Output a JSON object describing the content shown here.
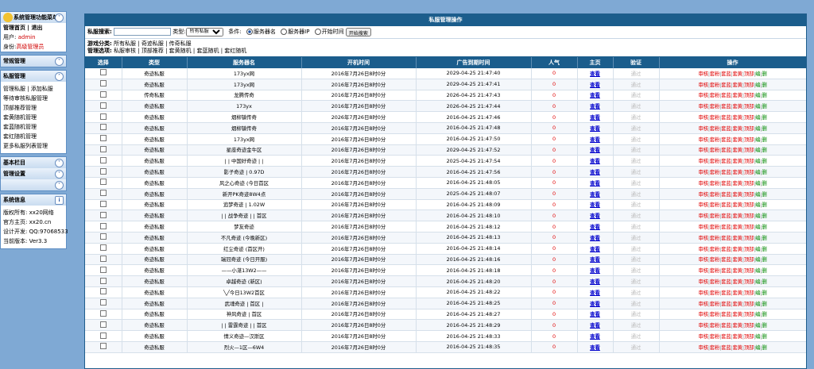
{
  "sidebar": {
    "title": "系统管理功能菜单",
    "home_label": "管理首页",
    "logout_label": "退出",
    "user_label": "用户:",
    "user_value": "admin",
    "role_label": "身份:",
    "role_value": "高级管理员",
    "sections": [
      {
        "label": "常规管理"
      },
      {
        "label": "私服管理",
        "items": [
          "管理私服 | 添加私服",
          "等待审核私服管理",
          "顶部推荐管理",
          "套黄随机管理",
          "套蓝随机管理",
          "套红随机管理",
          "更多私服列表管理"
        ]
      },
      {
        "label": "基本栏目"
      },
      {
        "label": "管理设置"
      }
    ],
    "sysinfo": {
      "title": "系统信息",
      "lines": [
        "版权所有: xx20网络",
        "官方主页: xx20.cn",
        "设计开发: QQ:97068533",
        "当前版本: Ver3.3"
      ]
    }
  },
  "main": {
    "title": "私服管理操作",
    "search": {
      "label": "私服搜索:",
      "input_value": "",
      "type_label": "类型:",
      "type_selected": "所有私服",
      "condition_label": "条件:",
      "options": [
        "服务器名",
        "服务器IP",
        "开始时间"
      ],
      "selected_option": 0,
      "button_label": "开始搜索"
    },
    "filters": {
      "cat_label": "游戏分类:",
      "cat_items": "所有私服 | 奇迹私服 | 传奇私服",
      "mgr_label": "管理选项:",
      "mgr_items": "私服审核 | 顶部推荐 | 套黄随机 | 套蓝随机 | 套红随机"
    },
    "columns": [
      "选择",
      "类型",
      "服务器名",
      "开机时间",
      "广告到期时间",
      "人气",
      "主页",
      "验证",
      "操作"
    ],
    "row_constants": {
      "popularity": "0",
      "homepage": "查看",
      "verify": "通过",
      "ops": [
        "审核",
        "套粉",
        "套蓝",
        "套黄",
        "顶部",
        "编",
        "删"
      ]
    },
    "rows": [
      {
        "type": "奇迹私服",
        "name": "173yx网",
        "start": "2016年7月26日8时0分",
        "expire": "2029-04-25 21:47:40"
      },
      {
        "type": "奇迹私服",
        "name": "173yx网",
        "start": "2016年7月26日8时0分",
        "expire": "2029-04-25 21:47:41"
      },
      {
        "type": "传奇私服",
        "name": "龙腾传奇",
        "start": "2016年7月26日8时0分",
        "expire": "2026-04-25 21:47:43"
      },
      {
        "type": "奇迹私服",
        "name": "173yx",
        "start": "2016年7月26日8时0分",
        "expire": "2026-04-25 21:47:44"
      },
      {
        "type": "奇迹私服",
        "name": "烟柳镇传奇",
        "start": "2026年7月26日8时0分",
        "expire": "2016-04-25 21:47:46"
      },
      {
        "type": "奇迹私服",
        "name": "烟柳镇传奇",
        "start": "2016年7月26日8时0分",
        "expire": "2016-04-25 21:47:48"
      },
      {
        "type": "奇迹私服",
        "name": "173yx网",
        "start": "2016年7月26日8时0分",
        "expire": "2016-04-25 21:47:50"
      },
      {
        "type": "奇迹私服",
        "name": "星座奇迹金牛区",
        "start": "2016年7月26日8时0分",
        "expire": "2029-04-25 21:47:52"
      },
      {
        "type": "奇迹私服",
        "name": "| | 中国好奇迹 | |",
        "start": "2016年7月26日8时0分",
        "expire": "2025-04-25 21:47:54"
      },
      {
        "type": "奇迹私服",
        "name": "影子奇迹 | 0.97D",
        "start": "2016年7月26日8时0分",
        "expire": "2016-04-25 21:47:56"
      },
      {
        "type": "奇迹私服",
        "name": "风之心奇迹 (今日首区",
        "start": "2016年7月26日8时0分",
        "expire": "2016-04-25 21:48:05"
      },
      {
        "type": "奇迹私服",
        "name": "新开PK奇迹8W4点",
        "start": "2016年7月26日8时0分",
        "expire": "2025-04-25 21:48:07"
      },
      {
        "type": "奇迹私服",
        "name": "追梦奇迹 | 1.02W",
        "start": "2016年7月26日8时0分",
        "expire": "2016-04-25 21:48:09"
      },
      {
        "type": "奇迹私服",
        "name": "| | 战争奇迹 | | 首区",
        "start": "2016年7月26日8时0分",
        "expire": "2016-04-25 21:48:10"
      },
      {
        "type": "奇迹私服",
        "name": "梦友奇迹",
        "start": "2016年7月26日8时0分",
        "expire": "2016-04-25 21:48:12"
      },
      {
        "type": "奇迹私服",
        "name": "不凡奇迹 (今晚新区)",
        "start": "2016年7月26日8时0分",
        "expire": "2016-04-25 21:48:13"
      },
      {
        "type": "奇迹私服",
        "name": "红尘奇迹 (首区开)",
        "start": "2016年7月26日8时0分",
        "expire": "2016-04-25 21:48:14"
      },
      {
        "type": "奇迹私服",
        "name": "瑞冠奇迹 (今日开服)",
        "start": "2016年7月26日8时0分",
        "expire": "2016-04-25 21:48:16"
      },
      {
        "type": "奇迹私服",
        "name": "——小湛13W2——",
        "start": "2016年7月26日8时0分",
        "expire": "2016-04-25 21:48:18"
      },
      {
        "type": "奇迹私服",
        "name": "卓越奇迹 (新区)",
        "start": "2016年7月26日8时0分",
        "expire": "2016-04-25 21:48:20"
      },
      {
        "type": "奇迹私服",
        "name": "╲╱今日13W2首区",
        "start": "2016年7月26日8时0分",
        "expire": "2016-04-25 21:48:22"
      },
      {
        "type": "奇迹私服",
        "name": "武魂奇迹 | 首区 |",
        "start": "2016年7月26日8时0分",
        "expire": "2016-04-25 21:48:25"
      },
      {
        "type": "奇迹私服",
        "name": "神风奇迹 | 首区",
        "start": "2016年7月26日8时0分",
        "expire": "2016-04-25 21:48:27"
      },
      {
        "type": "奇迹私服",
        "name": "| | 雷霆奇迹 | | 首区",
        "start": "2016年7月26日8时0分",
        "expire": "2016-04-25 21:48:29"
      },
      {
        "type": "奇迹私服",
        "name": "情义奇迹—汉斯区",
        "start": "2016年7月26日8时0分",
        "expire": "2016-04-25 21:48:33"
      },
      {
        "type": "奇迹私服",
        "name": "烈火—1区—6W4",
        "start": "2016年7月26日8时0分",
        "expire": "2016-04-25 21:48:35"
      }
    ]
  }
}
